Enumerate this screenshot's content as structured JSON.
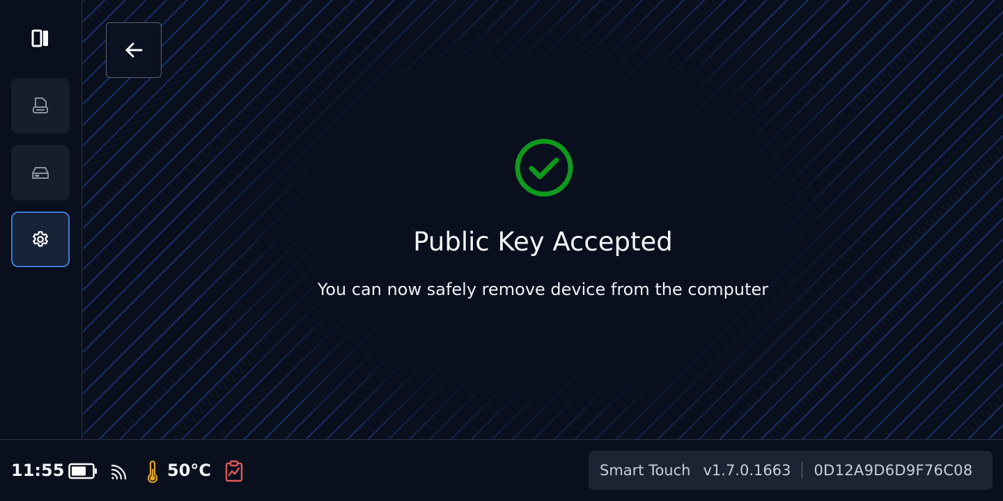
{
  "result": {
    "title": "Public Key Accepted",
    "message": "You can now safely remove device from the computer",
    "status_color": "#0f9a1e"
  },
  "sidebar": {
    "items": [
      {
        "icon": "panel-toggle-icon"
      },
      {
        "icon": "printer-document-icon"
      },
      {
        "icon": "drive-icon"
      },
      {
        "icon": "gear-icon",
        "active": true
      }
    ],
    "accent": "#3d7bd9"
  },
  "status_bar": {
    "time": "11:55",
    "temperature": "50°C",
    "battery_icon": "battery-icon",
    "signal_icon": "signal-icon",
    "thermometer_icon": "thermometer-icon",
    "report_icon": "clipboard-chart-icon",
    "thermometer_color": "#e3a321",
    "report_color": "#e05a5a"
  },
  "device": {
    "name": "Smart Touch",
    "version": "v1.7.0.1663",
    "serial": "0D12A9D6D9F76C08"
  }
}
